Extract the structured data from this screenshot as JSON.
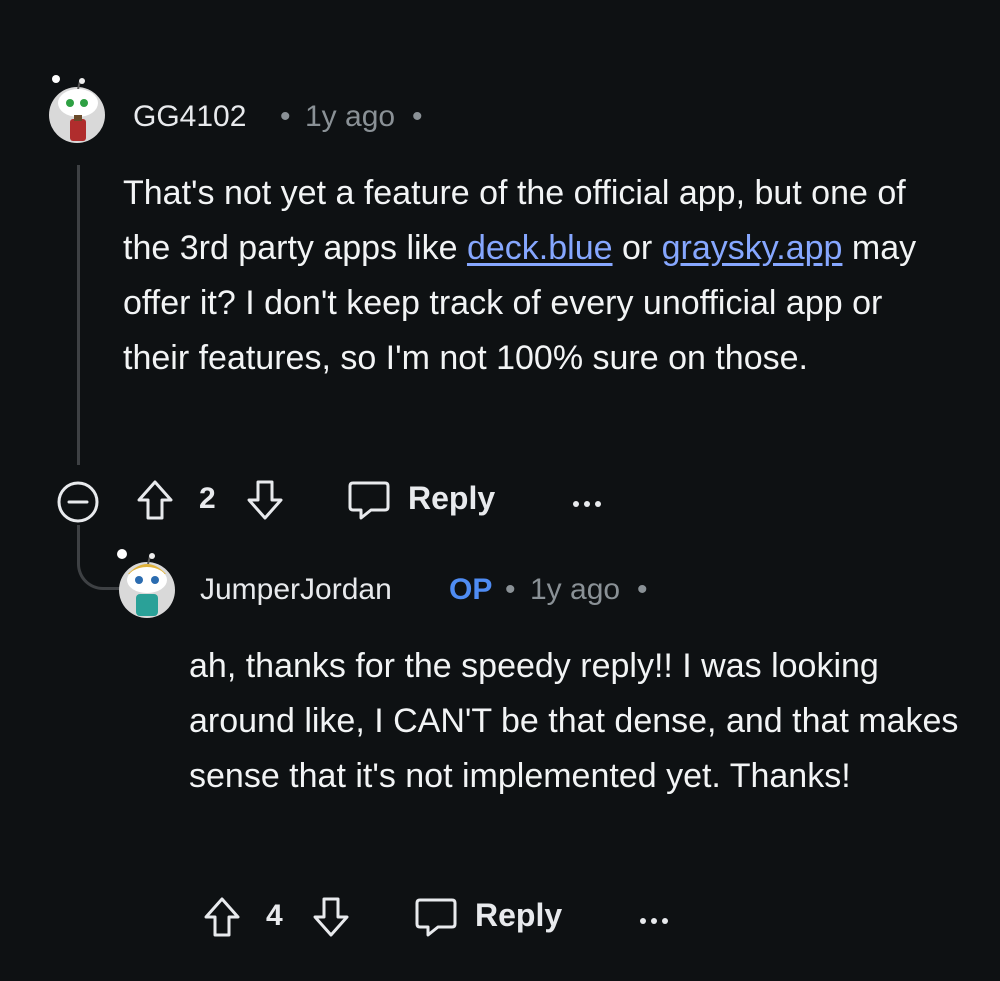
{
  "comment": {
    "username": "GG4102",
    "age": "1y ago",
    "body_before_link1": "That's not yet a feature of the official app, but one of the 3rd party apps like ",
    "link1": "deck.blue",
    "between_links": " or ",
    "link2": "graysky.app",
    "body_after_link2": " may offer it? I don't keep track of every unofficial app or their features, so I'm not 100% sure on those.",
    "votes": "2",
    "reply_label": "Reply"
  },
  "reply": {
    "username": "JumperJordan",
    "op_badge": "OP",
    "age": "1y ago",
    "body": "ah, thanks for the speedy reply!! I was looking around like, I CAN'T be that dense, and that makes sense that it's not implemented yet. Thanks!",
    "votes": "4",
    "reply_label": "Reply"
  },
  "colors": {
    "background": "#0e1113",
    "link": "#86a7ff",
    "op": "#4f8cf3",
    "meta": "#8a9196"
  }
}
